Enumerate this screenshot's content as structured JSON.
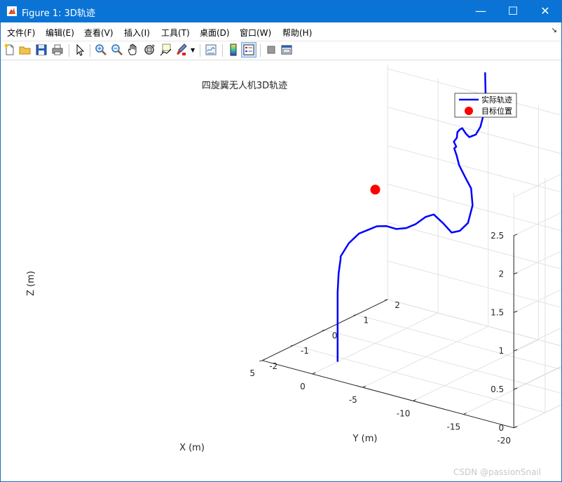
{
  "window": {
    "title": "Figure 1: 3D轨迹",
    "controls": {
      "minimize": "—",
      "maximize": "☐",
      "close": "✕"
    }
  },
  "menu": {
    "items": [
      "文件(F)",
      "编辑(E)",
      "查看(V)",
      "插入(I)",
      "工具(T)",
      "桌面(D)",
      "窗口(W)",
      "帮助(H)"
    ],
    "overflow_arrow": "↘"
  },
  "toolbar": {
    "buttons": [
      {
        "name": "new-figure-icon",
        "icon": "new-file"
      },
      {
        "name": "open-file-icon",
        "icon": "folder"
      },
      {
        "name": "save-figure-icon",
        "icon": "floppy"
      },
      {
        "name": "print-figure-icon",
        "icon": "printer"
      },
      {
        "name": "edit-plot-icon",
        "icon": "arrow-cursor"
      },
      {
        "name": "zoom-in-icon",
        "icon": "magnifier-plus"
      },
      {
        "name": "zoom-out-icon",
        "icon": "magnifier-minus"
      },
      {
        "name": "pan-icon",
        "icon": "hand"
      },
      {
        "name": "rotate-3d-icon",
        "icon": "rotate"
      },
      {
        "name": "data-cursor-icon",
        "icon": "data-tip"
      },
      {
        "name": "brush-icon",
        "icon": "brush"
      },
      {
        "name": "link-plot-icon",
        "icon": "link"
      },
      {
        "name": "insert-colorbar-icon",
        "icon": "colorbar"
      },
      {
        "name": "insert-legend-icon",
        "icon": "legend"
      },
      {
        "name": "hide-plot-tools-icon",
        "icon": "grey-square"
      },
      {
        "name": "show-plot-tools-icon",
        "icon": "panel"
      }
    ]
  },
  "chart_data": {
    "type": "line3d",
    "title": "四旋翼无人机3D轨迹",
    "xlabel": "X (m)",
    "ylabel": "Y (m)",
    "zlabel": "Z (m)",
    "xlim": [
      -20,
      5
    ],
    "ylim": [
      -2,
      2
    ],
    "zlim": [
      0,
      2.5
    ],
    "xticks": [
      "-20",
      "-15",
      "-10",
      "-5",
      "0",
      "5"
    ],
    "yticks": [
      "-2",
      "-1",
      "0",
      "1",
      "2"
    ],
    "zticks": [
      "0",
      "0.5",
      "1",
      "1.5",
      "2",
      "2.5"
    ],
    "grid": true,
    "legend": {
      "placement": "top-right",
      "entries": [
        {
          "label": "实际轨迹",
          "color": "#0000ff",
          "style": "line"
        },
        {
          "label": "目标位置",
          "color": "#ff0000",
          "style": "marker"
        }
      ]
    },
    "series": [
      {
        "name": "实际轨迹",
        "color": "#0000ff",
        "points": [
          [
            0.0,
            -1.2,
            0.0
          ],
          [
            0.0,
            -1.2,
            0.3
          ],
          [
            0.0,
            -1.2,
            0.6
          ],
          [
            0.0,
            -1.2,
            0.9
          ],
          [
            -0.1,
            -1.2,
            1.15
          ],
          [
            -0.3,
            -1.2,
            1.35
          ],
          [
            -0.3,
            -1.2,
            1.38
          ],
          [
            -0.8,
            -1.1,
            1.55
          ],
          [
            -1.5,
            -1.0,
            1.68
          ],
          [
            -2.0,
            -0.9,
            1.72
          ],
          [
            -2.5,
            -0.75,
            1.76
          ],
          [
            -3.0,
            -0.6,
            1.75
          ],
          [
            -3.5,
            -0.45,
            1.7
          ],
          [
            -4.0,
            -0.3,
            1.7
          ],
          [
            -4.5,
            -0.15,
            1.74
          ],
          [
            -5.0,
            0.0,
            1.82
          ],
          [
            -5.5,
            0.1,
            1.85
          ],
          [
            -6.0,
            0.25,
            1.72
          ],
          [
            -6.5,
            0.35,
            1.6
          ],
          [
            -7.0,
            0.45,
            1.62
          ],
          [
            -7.5,
            0.55,
            1.72
          ],
          [
            -7.8,
            0.6,
            1.95
          ],
          [
            -7.5,
            0.65,
            2.15
          ],
          [
            -6.8,
            0.7,
            2.25
          ],
          [
            -6.0,
            0.75,
            2.38
          ],
          [
            -5.6,
            0.8,
            2.48
          ],
          [
            -5.2,
            0.85,
            2.55
          ],
          [
            -5.4,
            0.85,
            2.58
          ],
          [
            -5.0,
            0.9,
            2.62
          ],
          [
            -5.3,
            0.9,
            2.68
          ],
          [
            -5.2,
            0.95,
            2.74
          ],
          [
            -5.6,
            0.9,
            2.8
          ],
          [
            -6.0,
            0.85,
            2.84
          ],
          [
            -6.5,
            0.8,
            2.8
          ],
          [
            -7.0,
            0.75,
            2.78
          ],
          [
            -7.5,
            0.8,
            2.82
          ],
          [
            -7.8,
            0.85,
            2.92
          ],
          [
            -8.0,
            0.9,
            3.1
          ],
          [
            -8.0,
            0.95,
            3.35
          ],
          [
            -7.8,
            1.0,
            3.6
          ]
        ]
      },
      {
        "name": "目标位置",
        "color": "#ff0000",
        "points": [
          [
            0,
            0,
            2
          ]
        ]
      }
    ]
  },
  "watermark": "CSDN @passionSnail"
}
